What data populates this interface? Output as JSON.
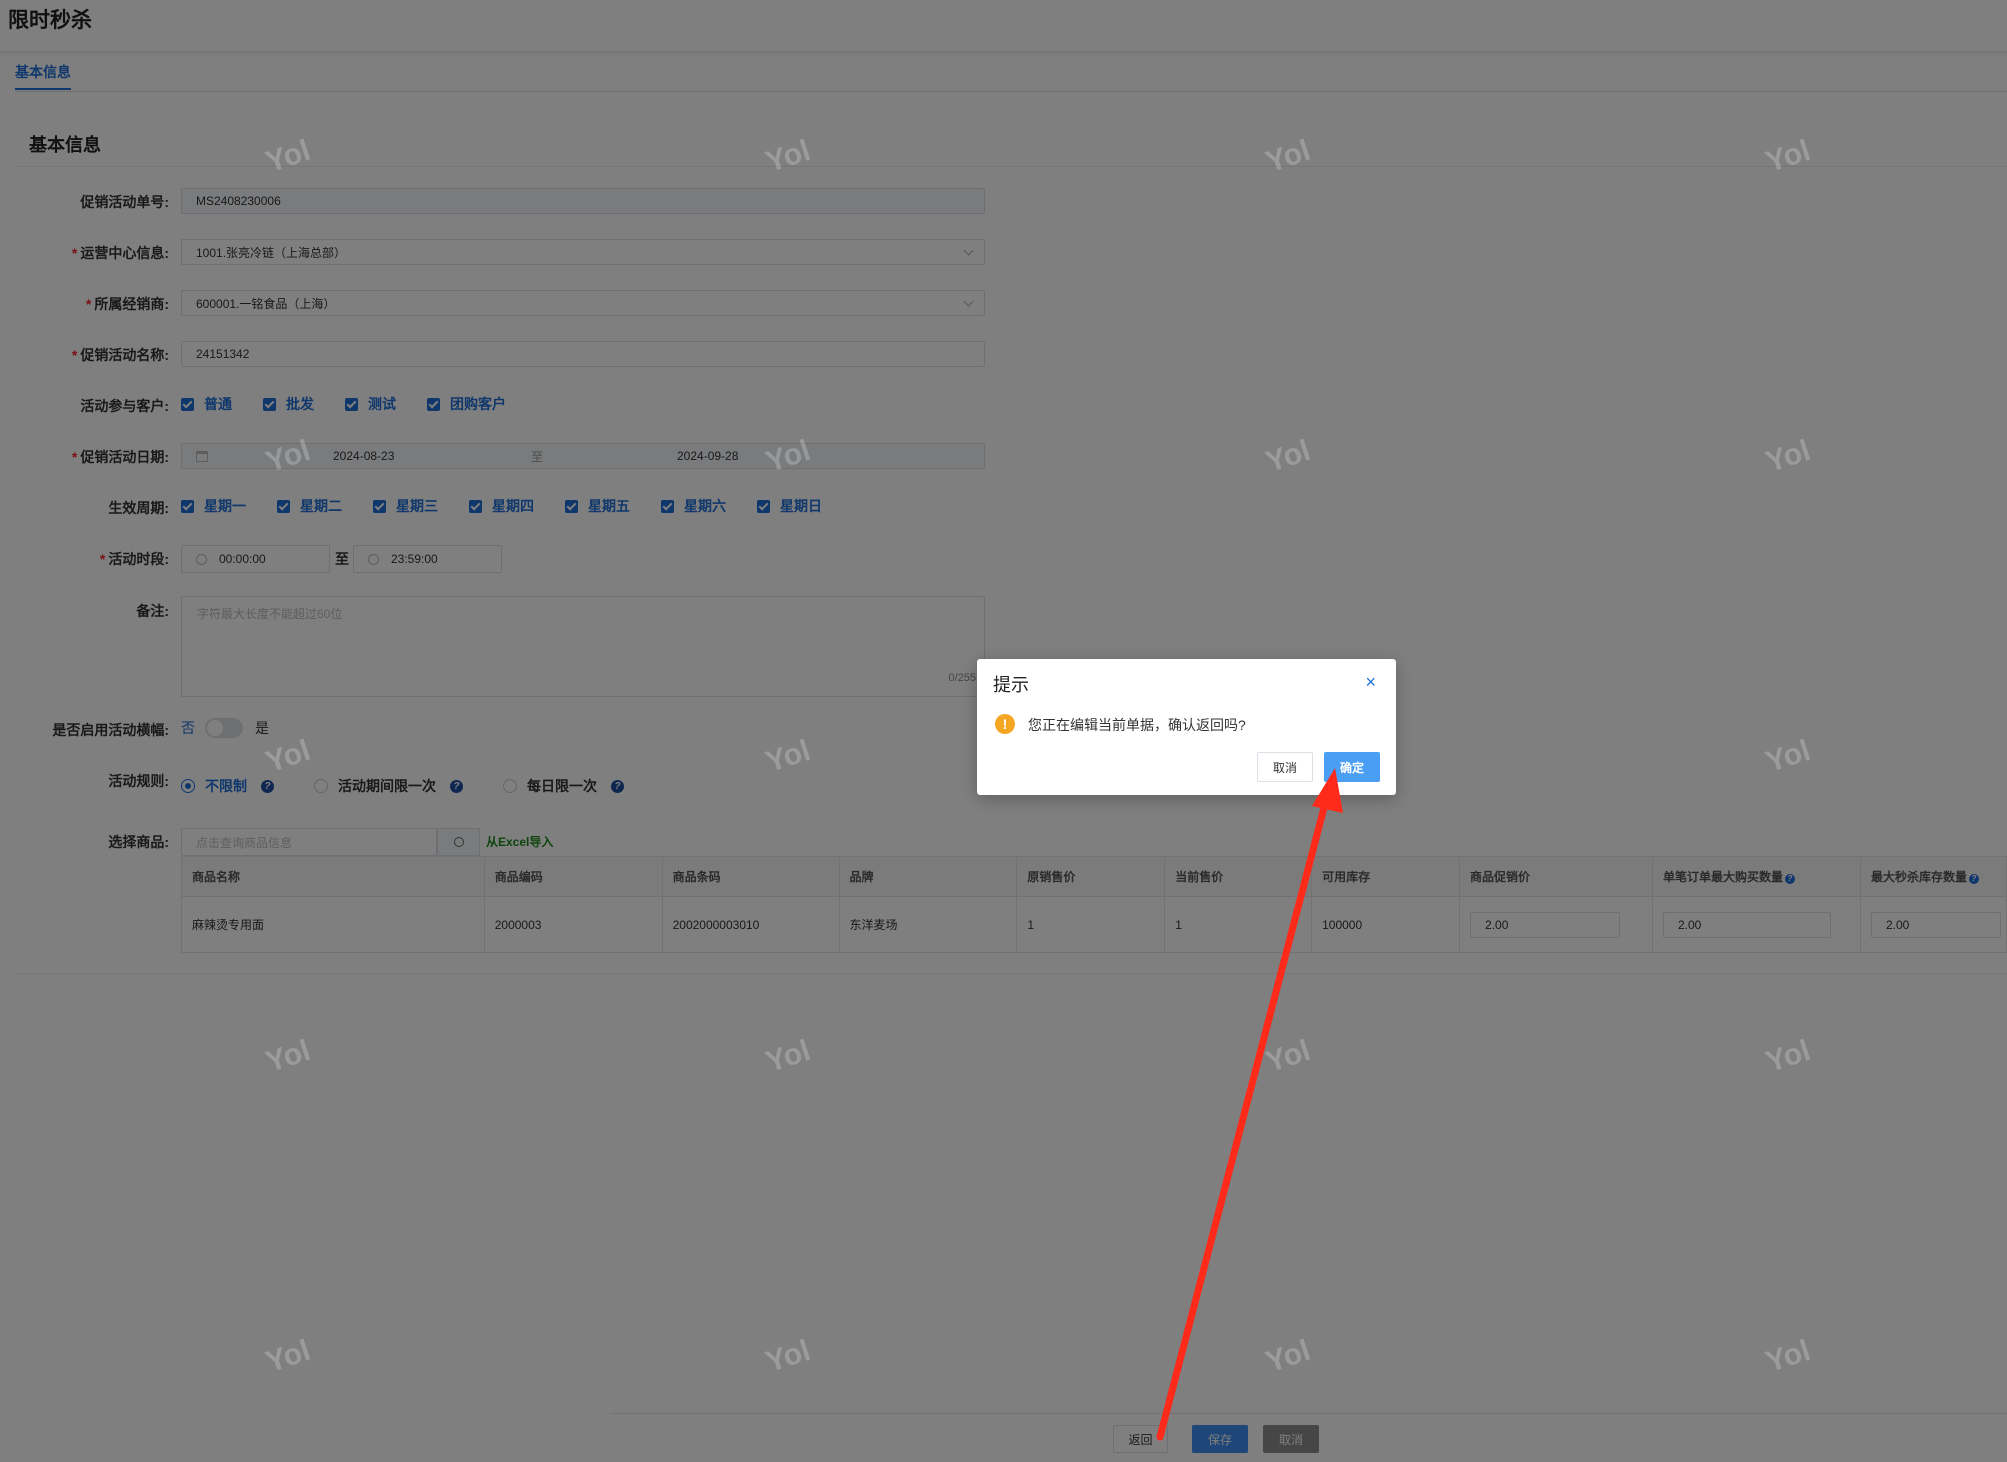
{
  "page": {
    "title": "限时秒杀"
  },
  "tabs": [
    {
      "label": "基本信息"
    }
  ],
  "section": {
    "title": "基本信息"
  },
  "form": {
    "order_no": {
      "label": "促销活动单号:",
      "value": "MS2408230006"
    },
    "ops_center": {
      "label": "运营中心信息:",
      "value": "1001.张亮冷链（上海总部）"
    },
    "dealer": {
      "label": "所属经销商:",
      "value": "600001.一铭食品（上海）"
    },
    "name": {
      "label": "促销活动名称:",
      "value": "24151342"
    },
    "customers": {
      "label": "活动参与客户:",
      "options": [
        "普通",
        "批发",
        "测试",
        "团购客户"
      ]
    },
    "date": {
      "label": "促销活动日期:",
      "start": "2024-08-23",
      "sep": "至",
      "end": "2024-09-28"
    },
    "weekdays": {
      "label": "生效周期:",
      "options": [
        "星期一",
        "星期二",
        "星期三",
        "星期四",
        "星期五",
        "星期六",
        "星期日"
      ]
    },
    "time": {
      "label": "活动时段:",
      "start": "00:00:00",
      "sep": "至",
      "end": "23:59:00"
    },
    "remark": {
      "label": "备注:",
      "placeholder": "字符最大长度不能超过60位",
      "counter": "0/255"
    },
    "banner": {
      "label": "是否启用活动横幅:",
      "off": "否",
      "on": "是"
    },
    "rules": {
      "label": "活动规则:",
      "options": [
        "不限制",
        "活动期间限一次",
        "每日限一次"
      ],
      "help": "?"
    },
    "goods": {
      "label": "选择商品:",
      "placeholder": "点击查询商品信息",
      "import": "从Excel导入"
    }
  },
  "table": {
    "headers": [
      "商品名称",
      "商品编码",
      "商品条码",
      "品牌",
      "原销售价",
      "当前售价",
      "可用库存",
      "商品促销价",
      "单笔订单最大购买数量",
      "最大秒杀库存数量"
    ],
    "rows": [
      [
        "麻辣烫专用面",
        "2000003",
        "2002000003010",
        "东洋麦场",
        "1",
        "1",
        "100000",
        "2.00",
        "2.00",
        "2.00"
      ]
    ]
  },
  "footer": {
    "back": "返回",
    "save": "保存",
    "cancel": "取消"
  },
  "watermark": "Yol",
  "dialog": {
    "title": "提示",
    "message": "您正在编辑当前单据，确认返回吗?",
    "cancel": "取消",
    "confirm": "确定",
    "warn_glyph": "!",
    "close_glyph": "×"
  },
  "colors": {
    "primary": "#1e6fd9",
    "required": "#f5222d",
    "confirm": "#4a9ff5",
    "warning": "#f5a623",
    "arrow": "#ff2a1a"
  }
}
